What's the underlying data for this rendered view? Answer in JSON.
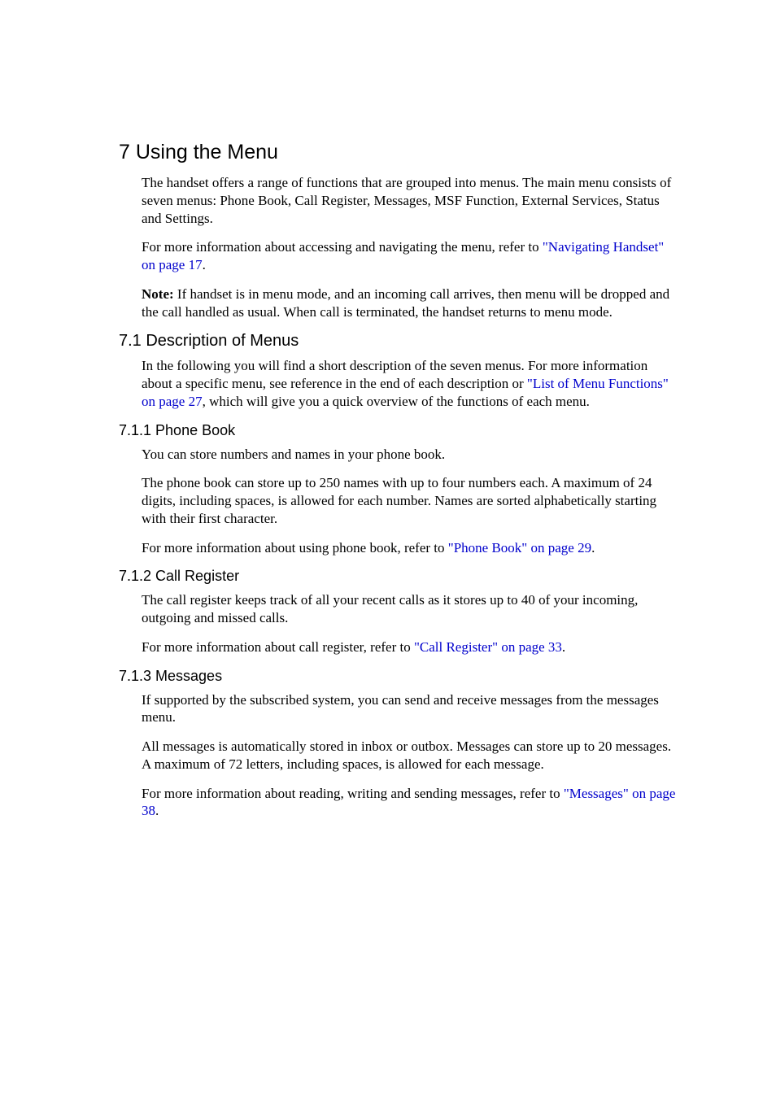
{
  "h1": "7 Using the Menu",
  "p1a": "The handset offers a range of functions that are grouped into menus. The main menu consists of seven menus: Phone Book, Call Register, Messages, MSF Function, External Services, Status and Settings.",
  "p2a": "For more information about accessing and navigating the menu, refer to ",
  "p2link": "\"Navigating Handset\" on page 17",
  "p2b": ".",
  "p3bold": "Note:",
  "p3a": " If handset is in menu mode, and an incoming call arrives, then menu will be dropped and the call handled as usual. When call is terminated, the handset returns to menu mode.",
  "h2_1": "7.1 Description of Menus",
  "p4a": "In the following you will find a short description of the seven menus. For more infor­mation about a specific menu, see reference in the end of each description or ",
  "p4link": "\"List of Menu Functions\" on page 27",
  "p4b": ", which will give you a quick overview of the functions of each menu.",
  "h3_1": "7.1.1 Phone Book",
  "p5": "You can store numbers and names in your phone book.",
  "p6": "The phone book can store up to 250 names with up to four numbers each. A maximum of 24 digits, including spaces, is allowed for each number. Names are sorted alphabeti­cally starting with their first character.",
  "p7a": "For more information about using phone book, refer to ",
  "p7link": "\"Phone Book\" on page 29",
  "p7b": ".",
  "h3_2": "7.1.2 Call Register",
  "p8": "The call register keeps track of all your recent calls as it stores up to 40 of your incom­ing, outgoing and missed calls.",
  "p9a": "For more information about call register, refer to ",
  "p9link": "\"Call Register\" on page 33",
  "p9b": ".",
  "h3_3": "7.1.3 Messages",
  "p10": "If supported by the subscribed system, you can send and receive messages from the messages menu.",
  "p11": "All messages is automatically stored in inbox or outbox. Messages can store up to 20 messages. A maximum of 72 letters, including spaces, is allowed for each message.",
  "p12a": "For more information about reading, writing and sending messages, refer to ",
  "p12link": "\"Mes­sages\" on page 38",
  "p12b": "."
}
